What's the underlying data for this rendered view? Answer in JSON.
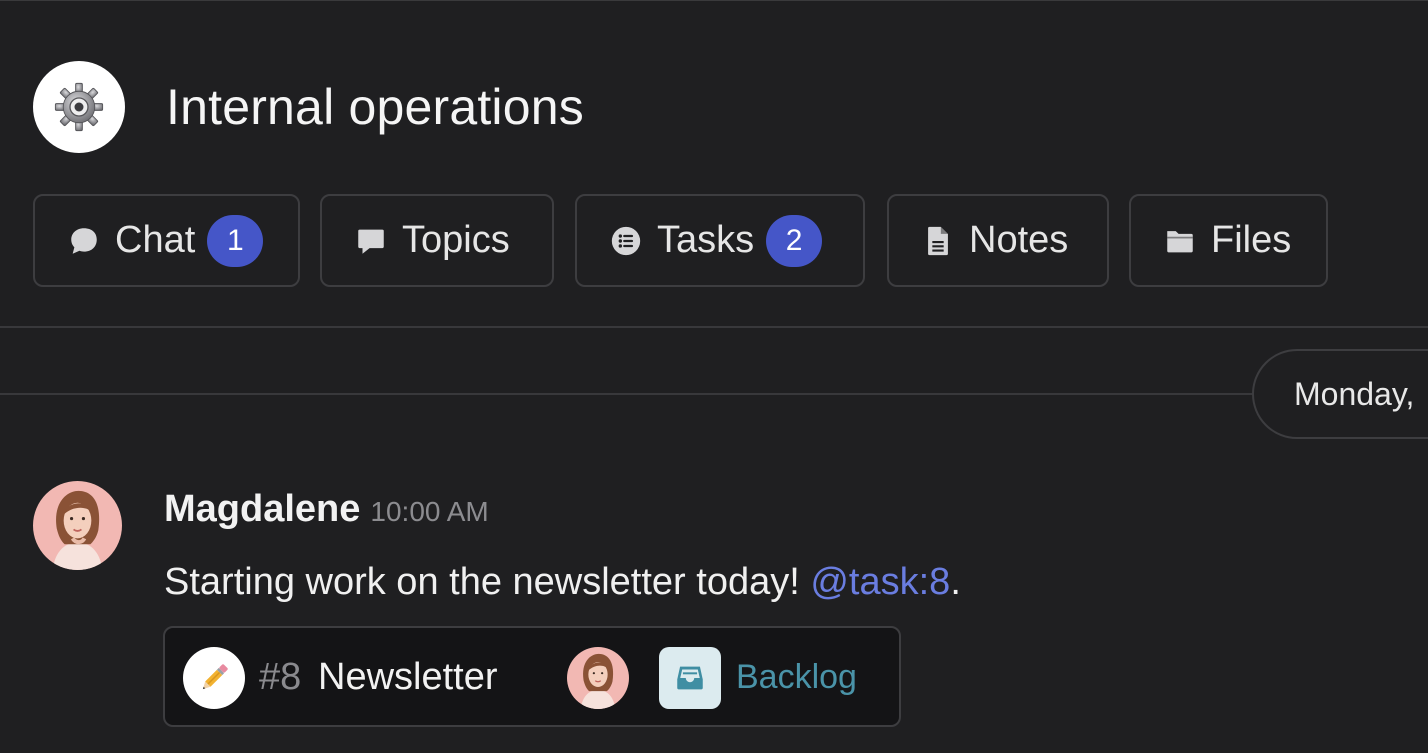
{
  "channel": {
    "title": "Internal operations",
    "icon": "gear-icon"
  },
  "tabs": [
    {
      "label": "Chat",
      "icon": "chat-bubble-icon",
      "badge": "1"
    },
    {
      "label": "Topics",
      "icon": "speech-bubble-icon"
    },
    {
      "label": "Tasks",
      "icon": "list-icon",
      "badge": "2"
    },
    {
      "label": "Notes",
      "icon": "document-icon"
    },
    {
      "label": "Files",
      "icon": "folder-icon"
    }
  ],
  "date_separator": "Monday,",
  "message": {
    "author": "Magdalene",
    "time": "10:00 AM",
    "text": "Starting work on the newsletter today! ",
    "mention": "@task:8",
    "suffix": ".",
    "task_card": {
      "icon": "pencil-icon",
      "number": "#8",
      "name": "Newsletter",
      "status": "Backlog",
      "status_icon": "inbox-tray-icon"
    }
  },
  "colors": {
    "background": "#1f1f21",
    "badge": "#4556c8",
    "mention": "#6a7de0",
    "status": "#4a93a8"
  }
}
